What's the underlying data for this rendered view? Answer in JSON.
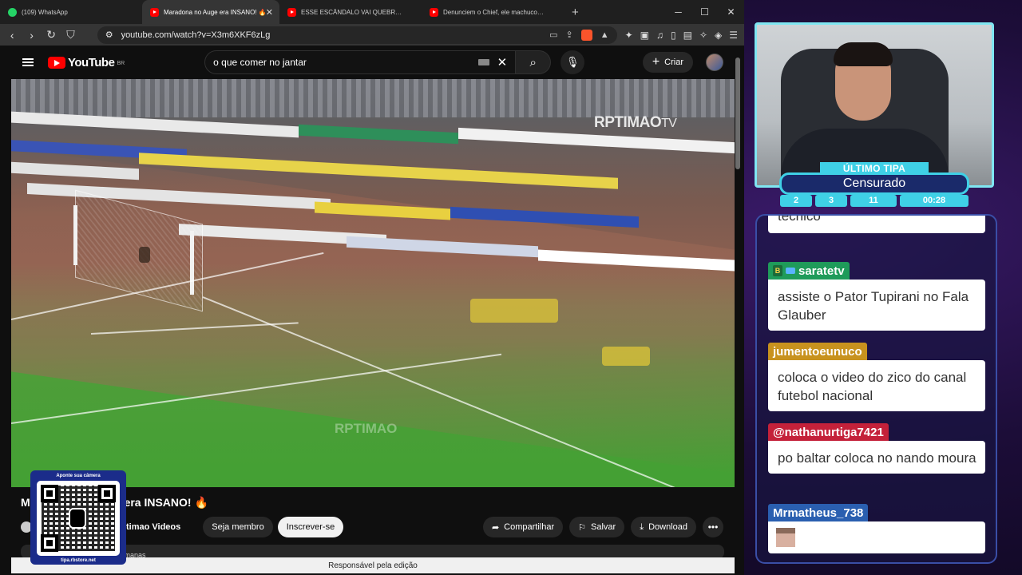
{
  "browser": {
    "tabs": [
      {
        "label": "(109) WhatsApp",
        "icon": "whatsapp-icon",
        "active": false
      },
      {
        "label": "Maradona no Auge era INSANO! 🔥",
        "icon": "youtube-icon",
        "active": true
      },
      {
        "label": "ESSE ESCÂNDALO VAI QUEBRAR O BRASIL",
        "icon": "youtube-icon",
        "active": false
      },
      {
        "label": "Denunciem o Chief, ele machucou meus sen",
        "icon": "youtube-icon",
        "active": false
      }
    ],
    "url": "youtube.com/watch?v=X3m6XKF6zLg",
    "brave_badge": "1"
  },
  "youtube": {
    "logo_text": "YouTube",
    "country": "BR",
    "search_value": "o que comer no jantar",
    "create_label": "Criar",
    "video_watermark": "RPTIMAO",
    "video_watermark_suffix": "TV",
    "video_watermark2": "RPTIMAO",
    "title_visible": "M",
    "title_rest": "era INSANO!",
    "title_emoji": "🔥",
    "channel_name": "timao Videos",
    "member_label": "Seja membro",
    "subscribe_label": "Inscrever-se",
    "share_label": "Compartilhar",
    "save_label": "Salvar",
    "download_label": "Download",
    "more_label": "•••",
    "desc_text": "semanas",
    "status_text": "Responsável pela edição"
  },
  "qr": {
    "top_text": "Aponte sua câmera",
    "bottom_text": "tipa.rbstore.net"
  },
  "overlay": {
    "tag_title": "ÚLTIMO TIPA",
    "tag_main": "Censurado",
    "stats": [
      "2",
      "3",
      "11",
      "00:28"
    ]
  },
  "chat": {
    "partial_text": "técnico",
    "messages": [
      {
        "user": "saratetv",
        "text": "assiste o Pator Tupirani no Fala Glauber",
        "color": "#1f9b5a"
      },
      {
        "user": "jumentoeunuco",
        "text": "coloca o video do zico do canal futebol nacional",
        "color": "#c8921e"
      },
      {
        "user": "@nathanurtiga7421",
        "text": "po baltar coloca no nando moura",
        "color": "#c4213a"
      },
      {
        "user": "Mrmatheus_738",
        "text": "",
        "color": "#2a5fb0"
      }
    ]
  }
}
